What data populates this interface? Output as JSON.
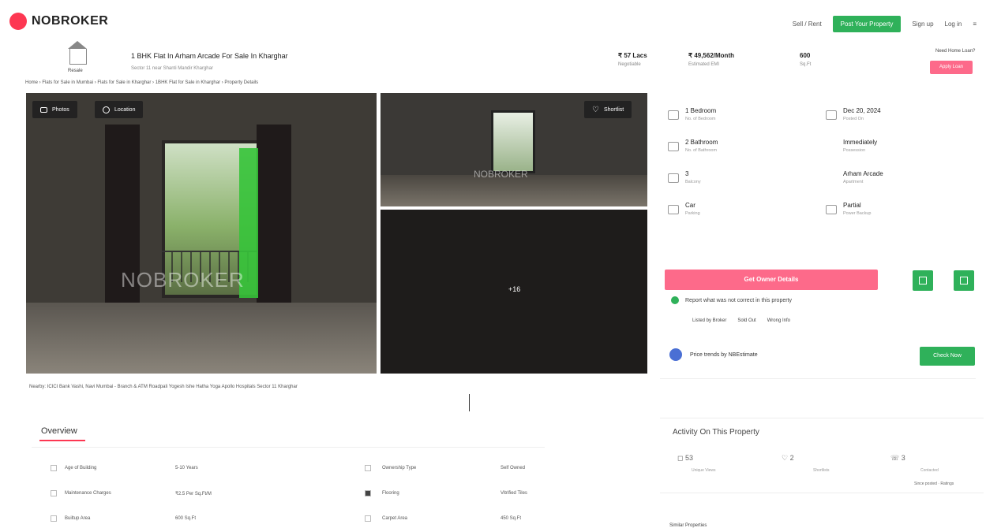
{
  "header": {
    "logo_text": "NOBROKER",
    "nav_links": [
      "Sell / Rent",
      "Post Your Property",
      "Sign up",
      "Log in"
    ],
    "brand_color": "#fd3752",
    "accent_green": "#2fb15a"
  },
  "property": {
    "house_caption": "Resale",
    "title": "1 BHK Flat In Arham Arcade For Sale In Kharghar",
    "subtitle": "Sector 11 near Shanti Mandir Kharghar",
    "price": "₹ 57 Lacs",
    "price_sub": "Negotiable",
    "emi": "₹ 49,562/Month",
    "emi_sub": "Estimated EMI",
    "area": "600",
    "area_sub": "Sq.Ft",
    "loan_question": "Need Home Loan?",
    "loan_button": "Apply Loan",
    "breadcrumb": "Home › Flats for Sale in Mumbai › Flats for Sale in Kharghar › 1BHK Flat for Sale in Kharghar › Property Details"
  },
  "gallery": {
    "photos_label": "Photos",
    "location_label": "Location",
    "shortlist_label": "Shortlist",
    "watermark": "NOBROKER",
    "more_count": "+16"
  },
  "nearby": "Nearby:  ICICI Bank Vashi, Navi Mumbai - Branch & ATM   Roadpali   Yogesh Ishe Hatha Yoga   Apollo Hospitals   Sector 11 Kharghar",
  "features": [
    {
      "value": "1 Bedroom",
      "label": "No. of Bedroom"
    },
    {
      "value": "Dec 20, 2024",
      "label": "Posted On"
    },
    {
      "value": "2 Bathroom",
      "label": "No. of Bathroom"
    },
    {
      "value": "Immediately",
      "label": "Possession"
    },
    {
      "value": "3",
      "label": "Balcony"
    },
    {
      "value": "Arham Arcade",
      "label": "Apartment"
    },
    {
      "value": "Car",
      "label": "Parking"
    },
    {
      "value": "Partial",
      "label": "Power Backup"
    }
  ],
  "contact_button": "Get Owner Details",
  "report": {
    "text": "Report what was not correct in this property",
    "tags": [
      "Listed by Broker",
      "Sold Out",
      "Wrong Info"
    ]
  },
  "trend": {
    "text": "Price trends by NBEstimate",
    "button": "Check Now"
  },
  "overview": {
    "heading": "Overview",
    "rows": [
      [
        "Age of Building",
        "5-10 Years",
        "Ownership Type",
        "Self Owned"
      ],
      [
        "Maintenance Charges",
        "₹2.5 Per Sq.Ft/M",
        "Flooring",
        "Vitrified Tiles"
      ],
      [
        "Builtup Area",
        "600 Sq.Ft",
        "Carpet Area",
        "450 Sq.Ft"
      ]
    ]
  },
  "activity": {
    "heading": "Activity On This Property",
    "items": [
      {
        "count": "53",
        "label": "Unique Views"
      },
      {
        "count": "2",
        "label": "Shortlists"
      },
      {
        "count": "3",
        "label": "Contacted"
      }
    ],
    "note": "Since posted · Ratings"
  },
  "similar_heading": "Similar Properties"
}
